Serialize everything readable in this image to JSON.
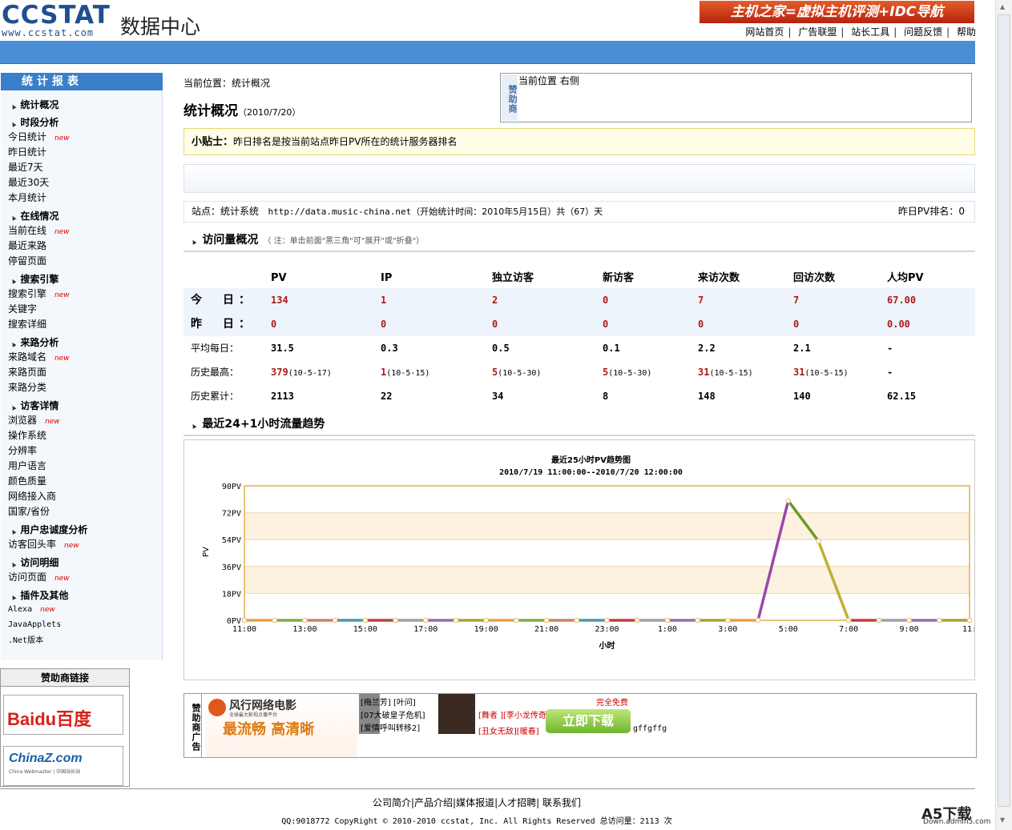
{
  "header": {
    "logo": "CCSTAT",
    "logo_url": "www.ccstat.com",
    "subtitle": "数据中心",
    "banner": "主机之家=虚拟主机评测+IDC导航",
    "nav": [
      "网站首页",
      "广告联盟",
      "站长工具",
      "问题反馈",
      "帮助"
    ]
  },
  "sidebar": {
    "title": "统计报表",
    "groups": [
      {
        "label": "统计概况",
        "items": []
      },
      {
        "label": "时段分析",
        "items": [
          {
            "label": "今日统计",
            "new": "new"
          },
          {
            "label": "昨日统计"
          },
          {
            "label": "最近7天"
          },
          {
            "label": "最近30天"
          },
          {
            "label": "本月统计"
          }
        ]
      },
      {
        "label": "在线情况",
        "items": [
          {
            "label": "当前在线",
            "new": "new"
          },
          {
            "label": "最近来路"
          },
          {
            "label": "停留页面"
          }
        ]
      },
      {
        "label": "搜索引擎",
        "items": [
          {
            "label": "搜索引擎",
            "new": "new"
          },
          {
            "label": "关键字"
          },
          {
            "label": "搜索详细"
          }
        ]
      },
      {
        "label": "来路分析",
        "items": [
          {
            "label": "来路域名",
            "new": "new"
          },
          {
            "label": "来路页面"
          },
          {
            "label": "来路分类"
          }
        ]
      },
      {
        "label": "访客详情",
        "items": [
          {
            "label": "浏览器",
            "new": "new"
          },
          {
            "label": "操作系统"
          },
          {
            "label": "分辨率"
          },
          {
            "label": "用户语言"
          },
          {
            "label": "颜色质量"
          },
          {
            "label": "网络接入商"
          },
          {
            "label": "国家/省份"
          }
        ]
      },
      {
        "label": "用户忠诚度分析",
        "items": [
          {
            "label": "访客回头率",
            "new": "new"
          }
        ]
      },
      {
        "label": "访问明细",
        "items": [
          {
            "label": "访问页面",
            "new": "new"
          }
        ]
      },
      {
        "label": "插件及其他",
        "items": [
          {
            "label": "Alexa",
            "new": "new"
          },
          {
            "label": "JavaApplets"
          },
          {
            "label": ".Net版本"
          }
        ]
      }
    ],
    "sponsor_title": "赞助商链接",
    "sponsor_logos": [
      "Baidu百度",
      "ChinaZ.com"
    ],
    "sponsor_logo_sub": "China Webmaster | 中国站长站"
  },
  "main": {
    "crumb": "当前位置：统计概况",
    "title": "统计概况",
    "date": "（2010/7/20）",
    "side_sponsor_tag": "赞助商",
    "side_sponsor_text": "当前位置 右侧",
    "tip_label": "小贴士：",
    "tip_text": "昨日排名是按当前站点昨日PV所在的统计服务器排名",
    "site_label": "站点：统计系统",
    "site_url": "http://data.music-china.net",
    "site_since": "（开始统计时间：2010年5月15日）共（67）天",
    "rank": "昨日PV排名：0",
    "overview_title": "访问量概况",
    "overview_note": "（ 注：单击前面\"黑三角\"可\"展开\"或\"折叠\"）",
    "trend_title": "最近24+1小时流量趋势"
  },
  "stats": {
    "columns": [
      "PV",
      "IP",
      "独立访客",
      "新访客",
      "来访次数",
      "回访次数",
      "人均PV"
    ],
    "rows": [
      {
        "label": "今　日：",
        "values": [
          "134",
          "1",
          "2",
          "0",
          "7",
          "7",
          "67.00"
        ]
      },
      {
        "label": "昨　日：",
        "values": [
          "0",
          "0",
          "0",
          "0",
          "0",
          "0",
          "0.00"
        ]
      },
      {
        "label": "平均每日：",
        "values": [
          "31.5",
          "0.3",
          "0.5",
          "0.1",
          "2.2",
          "2.1",
          "-"
        ]
      },
      {
        "label": "历史最高：",
        "values": [
          "379",
          "1",
          "5",
          "5",
          "31",
          "31",
          "-"
        ],
        "dates": [
          "(10-5-17)",
          "(10-5-15)",
          "(10-5-30)",
          "(10-5-30)",
          "(10-5-15)",
          "(10-5-15)",
          ""
        ]
      },
      {
        "label": "历史累计：",
        "values": [
          "2113",
          "22",
          "34",
          "8",
          "148",
          "140",
          "62.15"
        ]
      }
    ]
  },
  "chart_data": {
    "type": "line",
    "title": "最近25小时PV趋势图",
    "subtitle": "2010/7/19 11:00:00--2010/7/20 12:00:00",
    "xlabel": "小时",
    "ylabel": "PV",
    "x": [
      "11:00",
      "12:00",
      "13:00",
      "14:00",
      "15:00",
      "16:00",
      "17:00",
      "18:00",
      "19:00",
      "20:00",
      "21:00",
      "22:00",
      "23:00",
      "0:00",
      "1:00",
      "2:00",
      "3:00",
      "4:00",
      "5:00",
      "6:00",
      "7:00",
      "8:00",
      "9:00",
      "10:00",
      "11:00"
    ],
    "x_ticks": [
      "11:00",
      "13:00",
      "15:00",
      "17:00",
      "19:00",
      "21:00",
      "23:00",
      "1:00",
      "3:00",
      "5:00",
      "7:00",
      "9:00",
      "11:"
    ],
    "values": [
      0,
      0,
      0,
      0,
      0,
      0,
      0,
      0,
      0,
      0,
      0,
      0,
      0,
      0,
      0,
      0,
      0,
      0,
      80,
      53,
      0,
      0,
      0,
      0,
      0
    ],
    "ylim": [
      0,
      90
    ],
    "y_ticks": [
      "0PV",
      "18PV",
      "36PV",
      "54PV",
      "72PV",
      "90PV"
    ],
    "grid": true
  },
  "bottom_ad": {
    "tag": "赞助商广告",
    "brand": "风行网络电影",
    "slogan": "最流畅 高清晰",
    "brand_sub": "全球最大影视点播平台",
    "list1": [
      "[梅兰芳] [叶问]",
      "[07大破皇子危机]",
      "[爱情呼叫转移2]"
    ],
    "list2": [
      "[舞者 ][李小龙传奇]",
      "[丑女无敌][暖春]"
    ],
    "free": "完全免费",
    "download": "立即下载",
    "tail": "gffgffg"
  },
  "footer": {
    "links": "公司简介|产品介绍|媒体报道|人才招聘| 联系我们",
    "copyright": "QQ:9018772 CopyRight © 2010-2010 ccstat, Inc. All Rights Reserved 总访问量：2113 次",
    "watermark": "A5下载",
    "watermark_sub": "Down.admin5.com"
  }
}
